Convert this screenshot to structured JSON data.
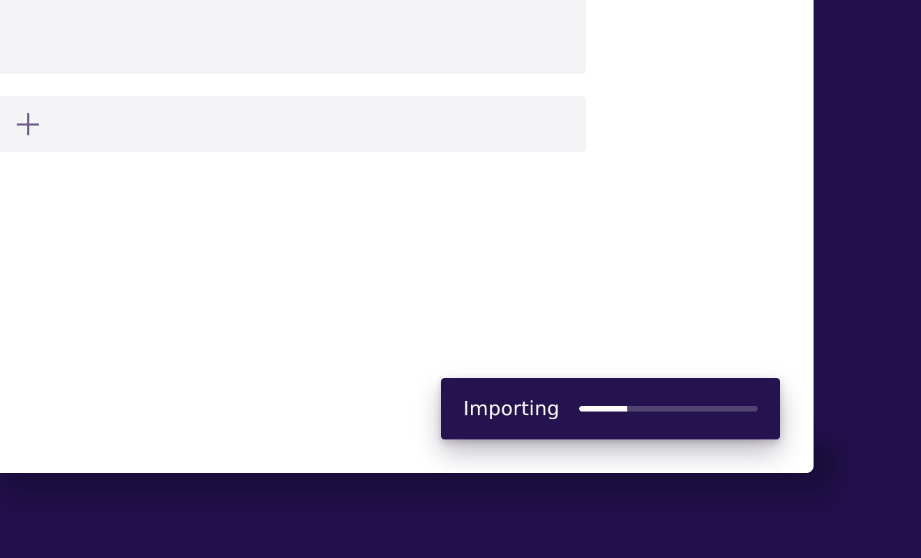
{
  "colors": {
    "background": "#22104c",
    "window": "#ffffff",
    "panel": "#f4f4f7",
    "toast": "#24134f",
    "progress_fill": "#ffffff",
    "progress_track": "#524470",
    "plus_icon": "#6e5b8c"
  },
  "icons": {
    "add": "plus-icon"
  },
  "toast": {
    "label": "Importing",
    "progress_fraction": 0.27
  }
}
